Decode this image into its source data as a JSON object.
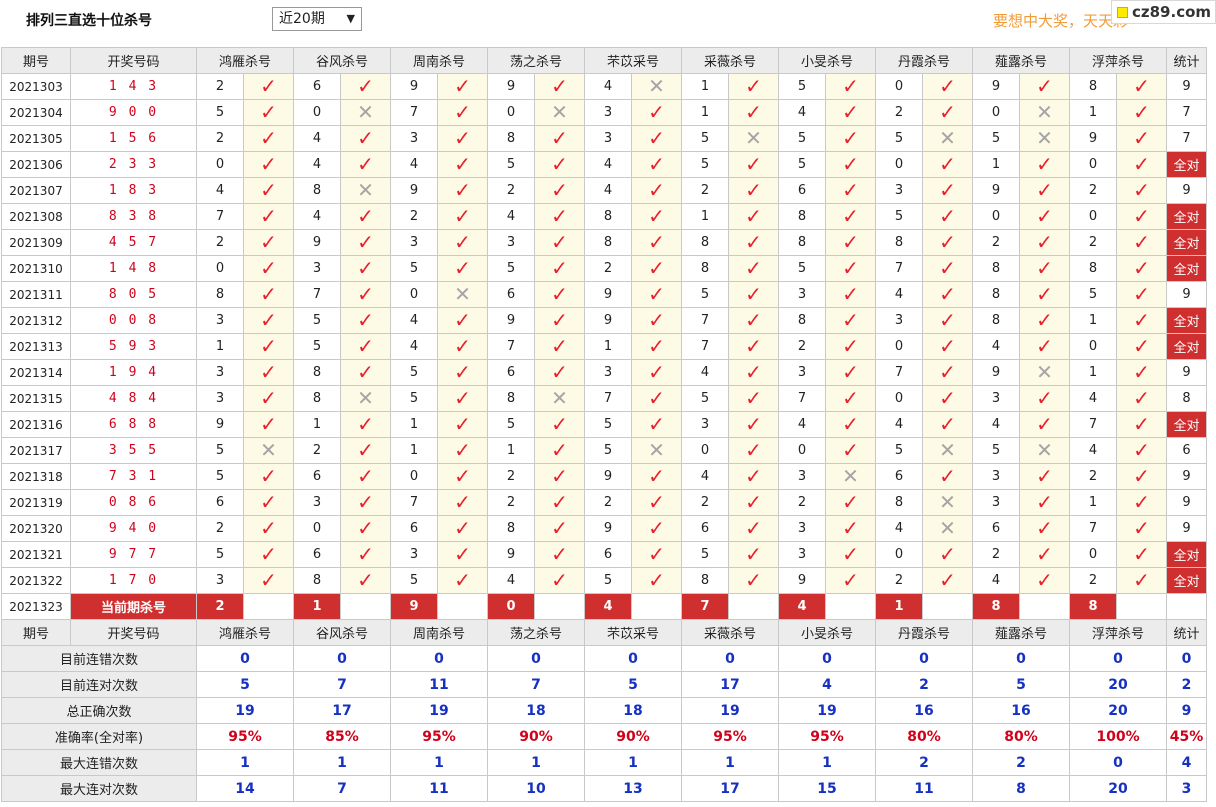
{
  "page": {
    "title": "排列三直选十位杀号",
    "select_value": "近20期",
    "marquee": "要想中大奖，天天彩",
    "logo": "cz89.com"
  },
  "headers": [
    "期号",
    "开奖号码",
    "鸿雁杀号",
    "谷风杀号",
    "周南杀号",
    "荡之杀号",
    "芣苡采号",
    "采薇杀号",
    "小旻杀号",
    "丹霞杀号",
    "薤露杀号",
    "浮萍杀号",
    "统计"
  ],
  "experts": [
    "鸿雁杀号",
    "谷风杀号",
    "周南杀号",
    "荡之杀号",
    "芣苡杀号",
    "采薇杀号",
    "小旻杀号",
    "丹霞杀号",
    "薤露杀号",
    "浮萍杀号"
  ],
  "rows": [
    {
      "issue": "2021303",
      "draw": "1 4 3",
      "kills": [
        [
          2,
          1
        ],
        [
          6,
          1
        ],
        [
          9,
          1
        ],
        [
          9,
          1
        ],
        [
          4,
          0
        ],
        [
          1,
          1
        ],
        [
          5,
          1
        ],
        [
          0,
          1
        ],
        [
          9,
          1
        ],
        [
          8,
          1
        ]
      ],
      "stat": "9"
    },
    {
      "issue": "2021304",
      "draw": "9 0 0",
      "kills": [
        [
          5,
          1
        ],
        [
          0,
          0
        ],
        [
          7,
          1
        ],
        [
          0,
          0
        ],
        [
          3,
          1
        ],
        [
          1,
          1
        ],
        [
          4,
          1
        ],
        [
          2,
          1
        ],
        [
          0,
          0
        ],
        [
          1,
          1
        ]
      ],
      "stat": "7"
    },
    {
      "issue": "2021305",
      "draw": "1 5 6",
      "kills": [
        [
          2,
          1
        ],
        [
          4,
          1
        ],
        [
          3,
          1
        ],
        [
          8,
          1
        ],
        [
          3,
          1
        ],
        [
          5,
          0
        ],
        [
          5,
          1
        ],
        [
          5,
          0
        ],
        [
          5,
          0
        ],
        [
          9,
          1
        ]
      ],
      "stat": "7"
    },
    {
      "issue": "2021306",
      "draw": "2 3 3",
      "kills": [
        [
          0,
          1
        ],
        [
          4,
          1
        ],
        [
          4,
          1
        ],
        [
          5,
          1
        ],
        [
          4,
          1
        ],
        [
          5,
          1
        ],
        [
          5,
          1
        ],
        [
          0,
          1
        ],
        [
          1,
          1
        ],
        [
          0,
          1
        ]
      ],
      "stat": "全对"
    },
    {
      "issue": "2021307",
      "draw": "1 8 3",
      "kills": [
        [
          4,
          1
        ],
        [
          8,
          0
        ],
        [
          9,
          1
        ],
        [
          2,
          1
        ],
        [
          4,
          1
        ],
        [
          2,
          1
        ],
        [
          6,
          1
        ],
        [
          3,
          1
        ],
        [
          9,
          1
        ],
        [
          2,
          1
        ]
      ],
      "stat": "9"
    },
    {
      "issue": "2021308",
      "draw": "8 3 8",
      "kills": [
        [
          7,
          1
        ],
        [
          4,
          1
        ],
        [
          2,
          1
        ],
        [
          4,
          1
        ],
        [
          8,
          1
        ],
        [
          1,
          1
        ],
        [
          8,
          1
        ],
        [
          5,
          1
        ],
        [
          0,
          1
        ],
        [
          0,
          1
        ]
      ],
      "stat": "全对"
    },
    {
      "issue": "2021309",
      "draw": "4 5 7",
      "kills": [
        [
          2,
          1
        ],
        [
          9,
          1
        ],
        [
          3,
          1
        ],
        [
          3,
          1
        ],
        [
          8,
          1
        ],
        [
          8,
          1
        ],
        [
          8,
          1
        ],
        [
          8,
          1
        ],
        [
          2,
          1
        ],
        [
          2,
          1
        ]
      ],
      "stat": "全对"
    },
    {
      "issue": "2021310",
      "draw": "1 4 8",
      "kills": [
        [
          0,
          1
        ],
        [
          3,
          1
        ],
        [
          5,
          1
        ],
        [
          5,
          1
        ],
        [
          2,
          1
        ],
        [
          8,
          1
        ],
        [
          5,
          1
        ],
        [
          7,
          1
        ],
        [
          8,
          1
        ],
        [
          8,
          1
        ]
      ],
      "stat": "全对"
    },
    {
      "issue": "2021311",
      "draw": "8 0 5",
      "kills": [
        [
          8,
          1
        ],
        [
          7,
          1
        ],
        [
          0,
          0
        ],
        [
          6,
          1
        ],
        [
          9,
          1
        ],
        [
          5,
          1
        ],
        [
          3,
          1
        ],
        [
          4,
          1
        ],
        [
          8,
          1
        ],
        [
          5,
          1
        ]
      ],
      "stat": "9"
    },
    {
      "issue": "2021312",
      "draw": "0 0 8",
      "kills": [
        [
          3,
          1
        ],
        [
          5,
          1
        ],
        [
          4,
          1
        ],
        [
          9,
          1
        ],
        [
          9,
          1
        ],
        [
          7,
          1
        ],
        [
          8,
          1
        ],
        [
          3,
          1
        ],
        [
          8,
          1
        ],
        [
          1,
          1
        ]
      ],
      "stat": "全对"
    },
    {
      "issue": "2021313",
      "draw": "5 9 3",
      "kills": [
        [
          1,
          1
        ],
        [
          5,
          1
        ],
        [
          4,
          1
        ],
        [
          7,
          1
        ],
        [
          1,
          1
        ],
        [
          7,
          1
        ],
        [
          2,
          1
        ],
        [
          0,
          1
        ],
        [
          4,
          1
        ],
        [
          0,
          1
        ]
      ],
      "stat": "全对"
    },
    {
      "issue": "2021314",
      "draw": "1 9 4",
      "kills": [
        [
          3,
          1
        ],
        [
          8,
          1
        ],
        [
          5,
          1
        ],
        [
          6,
          1
        ],
        [
          3,
          1
        ],
        [
          4,
          1
        ],
        [
          3,
          1
        ],
        [
          7,
          1
        ],
        [
          9,
          0
        ],
        [
          1,
          1
        ]
      ],
      "stat": "9"
    },
    {
      "issue": "2021315",
      "draw": "4 8 4",
      "kills": [
        [
          3,
          1
        ],
        [
          8,
          0
        ],
        [
          5,
          1
        ],
        [
          8,
          0
        ],
        [
          7,
          1
        ],
        [
          5,
          1
        ],
        [
          7,
          1
        ],
        [
          0,
          1
        ],
        [
          3,
          1
        ],
        [
          4,
          1
        ]
      ],
      "stat": "8"
    },
    {
      "issue": "2021316",
      "draw": "6 8 8",
      "kills": [
        [
          9,
          1
        ],
        [
          1,
          1
        ],
        [
          1,
          1
        ],
        [
          5,
          1
        ],
        [
          5,
          1
        ],
        [
          3,
          1
        ],
        [
          4,
          1
        ],
        [
          4,
          1
        ],
        [
          4,
          1
        ],
        [
          7,
          1
        ]
      ],
      "stat": "全对"
    },
    {
      "issue": "2021317",
      "draw": "3 5 5",
      "kills": [
        [
          5,
          0
        ],
        [
          2,
          1
        ],
        [
          1,
          1
        ],
        [
          1,
          1
        ],
        [
          5,
          0
        ],
        [
          0,
          1
        ],
        [
          0,
          1
        ],
        [
          5,
          0
        ],
        [
          5,
          0
        ],
        [
          4,
          1
        ]
      ],
      "stat": "6"
    },
    {
      "issue": "2021318",
      "draw": "7 3 1",
      "kills": [
        [
          5,
          1
        ],
        [
          6,
          1
        ],
        [
          0,
          1
        ],
        [
          2,
          1
        ],
        [
          9,
          1
        ],
        [
          4,
          1
        ],
        [
          3,
          0
        ],
        [
          6,
          1
        ],
        [
          3,
          1
        ],
        [
          2,
          1
        ]
      ],
      "stat": "9"
    },
    {
      "issue": "2021319",
      "draw": "0 8 6",
      "kills": [
        [
          6,
          1
        ],
        [
          3,
          1
        ],
        [
          7,
          1
        ],
        [
          2,
          1
        ],
        [
          2,
          1
        ],
        [
          2,
          1
        ],
        [
          2,
          1
        ],
        [
          8,
          0
        ],
        [
          3,
          1
        ],
        [
          1,
          1
        ]
      ],
      "stat": "9"
    },
    {
      "issue": "2021320",
      "draw": "9 4 0",
      "kills": [
        [
          2,
          1
        ],
        [
          0,
          1
        ],
        [
          6,
          1
        ],
        [
          8,
          1
        ],
        [
          9,
          1
        ],
        [
          6,
          1
        ],
        [
          3,
          1
        ],
        [
          4,
          0
        ],
        [
          6,
          1
        ],
        [
          7,
          1
        ]
      ],
      "stat": "9"
    },
    {
      "issue": "2021321",
      "draw": "9 7 7",
      "kills": [
        [
          5,
          1
        ],
        [
          6,
          1
        ],
        [
          3,
          1
        ],
        [
          9,
          1
        ],
        [
          6,
          1
        ],
        [
          5,
          1
        ],
        [
          3,
          1
        ],
        [
          0,
          1
        ],
        [
          2,
          1
        ],
        [
          0,
          1
        ]
      ],
      "stat": "全对"
    },
    {
      "issue": "2021322",
      "draw": "1 7 0",
      "kills": [
        [
          3,
          1
        ],
        [
          8,
          1
        ],
        [
          5,
          1
        ],
        [
          4,
          1
        ],
        [
          5,
          1
        ],
        [
          8,
          1
        ],
        [
          9,
          1
        ],
        [
          2,
          1
        ],
        [
          4,
          1
        ],
        [
          2,
          1
        ]
      ],
      "stat": "全对"
    }
  ],
  "current": {
    "issue": "2021323",
    "label": "当前期杀号",
    "kills": [
      "2",
      "1",
      "9",
      "0",
      "4",
      "7",
      "4",
      "1",
      "8",
      "8"
    ]
  },
  "stats": [
    {
      "label": "目前连错次数",
      "values": [
        "0",
        "0",
        "0",
        "0",
        "0",
        "0",
        "0",
        "0",
        "0",
        "0"
      ],
      "total": "0"
    },
    {
      "label": "目前连对次数",
      "values": [
        "5",
        "7",
        "11",
        "7",
        "5",
        "17",
        "4",
        "2",
        "5",
        "20"
      ],
      "total": "2"
    },
    {
      "label": "总正确次数",
      "values": [
        "19",
        "17",
        "19",
        "18",
        "18",
        "19",
        "19",
        "16",
        "16",
        "20"
      ],
      "total": "9"
    },
    {
      "label": "准确率(全对率)",
      "values": [
        "95%",
        "85%",
        "95%",
        "90%",
        "90%",
        "95%",
        "95%",
        "80%",
        "80%",
        "100%"
      ],
      "total": "45%"
    },
    {
      "label": "最大连错次数",
      "values": [
        "1",
        "1",
        "1",
        "1",
        "1",
        "1",
        "1",
        "2",
        "2",
        "0"
      ],
      "total": "4"
    },
    {
      "label": "最大连对次数",
      "values": [
        "14",
        "7",
        "11",
        "10",
        "13",
        "17",
        "15",
        "11",
        "8",
        "20"
      ],
      "total": "3"
    }
  ],
  "icons": {
    "correct": "check-icon",
    "wrong": "cross-icon"
  },
  "colors": {
    "accent_red": "#cf2f2f",
    "check_red": "#ea1f2b",
    "stat_blue": "#1631c2",
    "draw_red": "#d0021b",
    "mark_bg": "#fdfbe5",
    "header_bg": "#ececec"
  }
}
